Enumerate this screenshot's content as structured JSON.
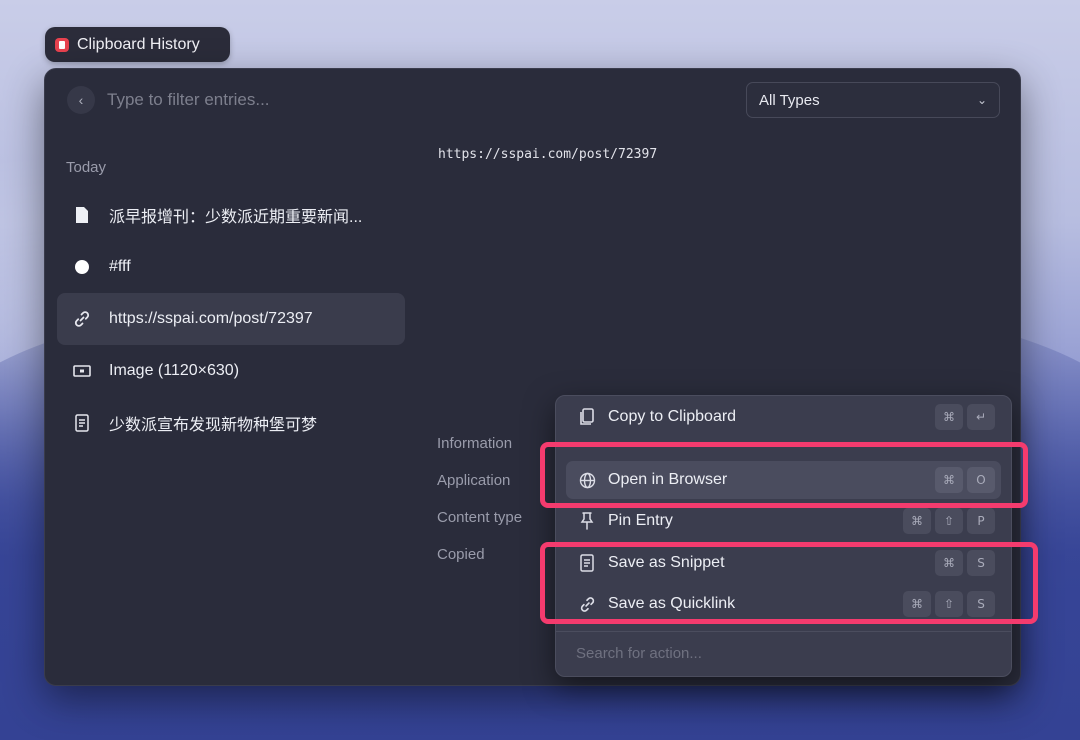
{
  "app": {
    "title": "Clipboard History",
    "logo_color": "#e8424f"
  },
  "topbar": {
    "search_placeholder": "Type to filter entries...",
    "filter_value": "All Types"
  },
  "list": {
    "section": "Today",
    "items": [
      {
        "icon": "document-icon",
        "label": "派早报增刊：少数派近期重要新闻..."
      },
      {
        "icon": "color-dot-icon",
        "label": "#fff"
      },
      {
        "icon": "link-icon",
        "label": "https://sspai.com/post/72397",
        "selected": true
      },
      {
        "icon": "image-icon",
        "label": "Image (1120×630)"
      },
      {
        "icon": "text-file-icon",
        "label": "少数派宣布发现新物种堡可梦"
      }
    ]
  },
  "preview": {
    "content": "https://sspai.com/post/72397"
  },
  "info": {
    "labels": [
      "Information",
      "Application",
      "Content type",
      "Copied"
    ]
  },
  "action_menu": {
    "items": [
      {
        "icon": "clipboard-icon",
        "label": "Copy to Clipboard",
        "keys": [
          "⌘",
          "↵"
        ]
      },
      {
        "icon": "globe-icon",
        "label": "Open in Browser",
        "keys": [
          "⌘",
          "O"
        ],
        "active": true
      },
      {
        "icon": "pin-icon",
        "label": "Pin Entry",
        "keys": [
          "⌘",
          "⇧",
          "P"
        ]
      },
      {
        "icon": "snippet-icon",
        "label": "Save as Snippet",
        "keys": [
          "⌘",
          "S"
        ]
      },
      {
        "icon": "link-icon",
        "label": "Save as Quicklink",
        "keys": [
          "⌘",
          "⇧",
          "S"
        ]
      }
    ],
    "search_placeholder": "Search for action..."
  },
  "colors": {
    "highlight": "#f43b6e",
    "window_bg": "#2a2c3b"
  }
}
